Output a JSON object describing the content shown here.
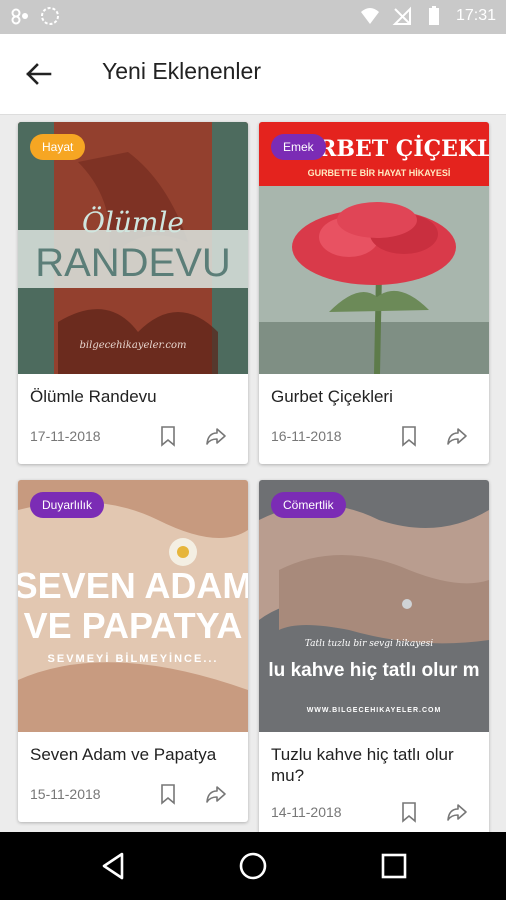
{
  "status_bar": {
    "time": "17:31"
  },
  "app_bar": {
    "title": "Yeni Eklenenler"
  },
  "cards": [
    {
      "badge": "Hayat",
      "image_text_top": "Ölümle",
      "image_text_main": "RANDEVU",
      "image_watermark": "bilgecehikayeler.com",
      "title": "Ölümle Randevu",
      "date": "17-11-2018"
    },
    {
      "badge": "Emek",
      "image_text_top": "GURBET ÇİÇEKLERİ",
      "image_text_sub": "GURBETTE BİR HAYAT HİKAYESİ",
      "title": "Gurbet Çiçekleri",
      "date": "16-11-2018"
    },
    {
      "badge": "Duyarlılık",
      "image_text_top": "SEVEN ADAM",
      "image_text_main": "VE PAPATYA",
      "image_text_sub": "SEVMEYİ BİLMEYİNCE...",
      "title": "Seven Adam ve Papatya",
      "date": "15-11-2018"
    },
    {
      "badge": "Cömertlik",
      "image_text_small": "Tatlı tuzlu bir sevgi hikayesi",
      "image_text_main": "lu kahve hiç tatlı olur m",
      "image_watermark": "WWW.BILGECEHIKAYELER.COM",
      "title": "Tuzlu kahve hiç tatlı olur mu?",
      "date": "14-11-2018"
    }
  ]
}
